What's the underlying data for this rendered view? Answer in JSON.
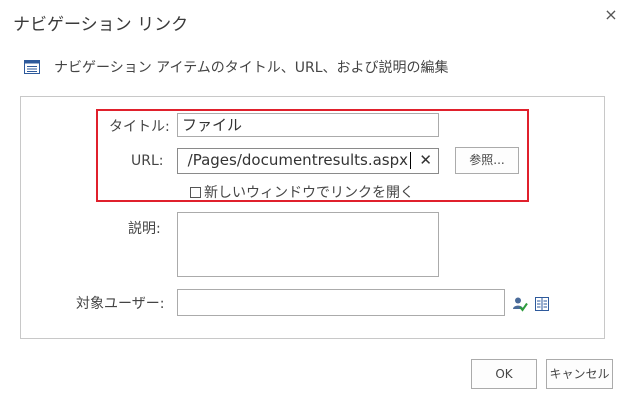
{
  "dialog": {
    "title": "ナビゲーション リンク",
    "close_glyph": "×",
    "subheading": "ナビゲーション アイテムのタイトル、URL、および説明の編集"
  },
  "form": {
    "title_label": "タイトル:",
    "title_value": "ファイル",
    "url_label": "URL:",
    "url_value": "/Pages/documentresults.aspx",
    "url_clear_glyph": "✕",
    "browse_button": "参照...",
    "new_window_label": "新しいウィンドウでリンクを開く",
    "new_window_checked": false,
    "description_label": "説明:",
    "description_value": "",
    "audience_label": "対象ユーザー:",
    "audience_value": ""
  },
  "footer": {
    "ok_button": "OK",
    "cancel_button": "キャンセル"
  },
  "colors": {
    "highlight_border": "#e0202c",
    "panel_border": "#c8c8c8",
    "input_border": "#ababab"
  },
  "icons": {
    "subheading_icon": "list-icon",
    "check_names_icon": "check-names-icon",
    "browse_people_icon": "address-book-icon"
  }
}
